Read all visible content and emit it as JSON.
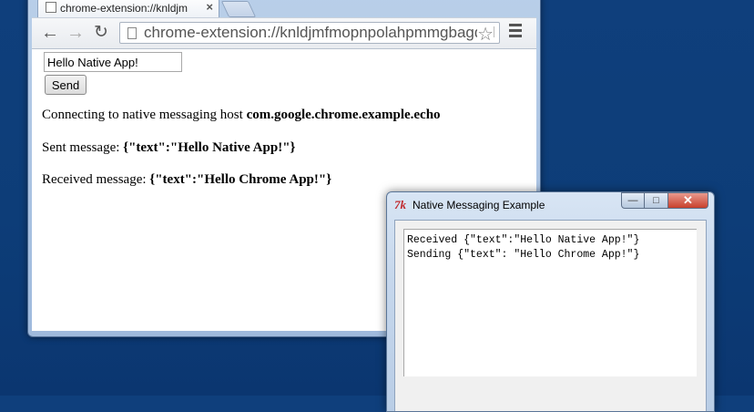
{
  "chrome": {
    "tab_title": "chrome-extension://knldjm",
    "tab_close": "×",
    "url": "chrome-extension://knldjmfmopnpolahpmmgbagdol",
    "nav": {
      "back": "←",
      "forward": "→",
      "reload": "↻",
      "star": "☆"
    },
    "page": {
      "input_value": "Hello Native App!",
      "send_label": "Send",
      "line1_prefix": "Connecting to native messaging host ",
      "line1_host": "com.google.chrome.example.echo",
      "line2_prefix": "Sent message: ",
      "line2_value": "{\"text\":\"Hello Native App!\"}",
      "line3_prefix": "Received message: ",
      "line3_value": "{\"text\":\"Hello Chrome App!\"}"
    }
  },
  "tk_window": {
    "logo": "7k",
    "title": "Native Messaging Example",
    "min": "—",
    "max": "□",
    "close": "✕",
    "lines": [
      "Received {\"text\":\"Hello Native App!\"}",
      "Sending {\"text\": \"Hello Chrome App!\"}"
    ]
  }
}
